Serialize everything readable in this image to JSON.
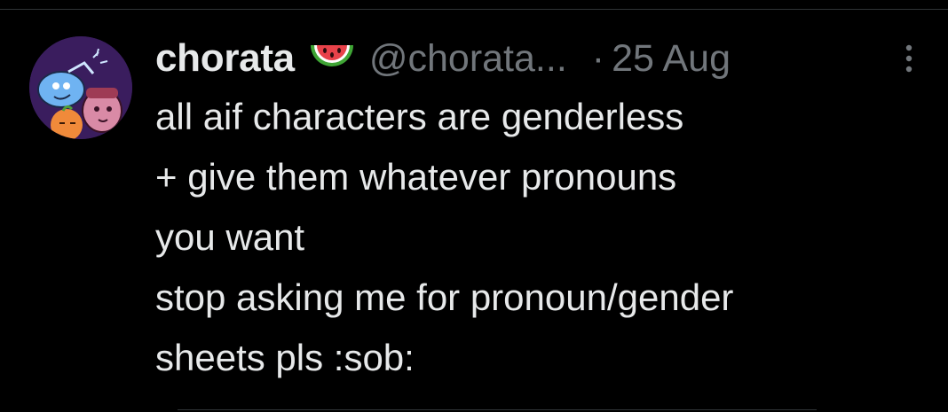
{
  "post": {
    "display_name": "chorata",
    "badge_icon": "watermelon-icon",
    "handle": "@chorata...",
    "separator": "·",
    "timestamp": "25 Aug",
    "more_icon": "more-vertical-icon",
    "body_lines": [
      "all aif characters are genderless",
      "+ give them whatever pronouns",
      "you want",
      "stop asking me for pronoun/gender",
      "sheets pls :sob:"
    ]
  },
  "colors": {
    "background": "#000000",
    "text_primary": "#e7e9ea",
    "text_secondary": "#71767b",
    "divider": "#2f3336"
  }
}
